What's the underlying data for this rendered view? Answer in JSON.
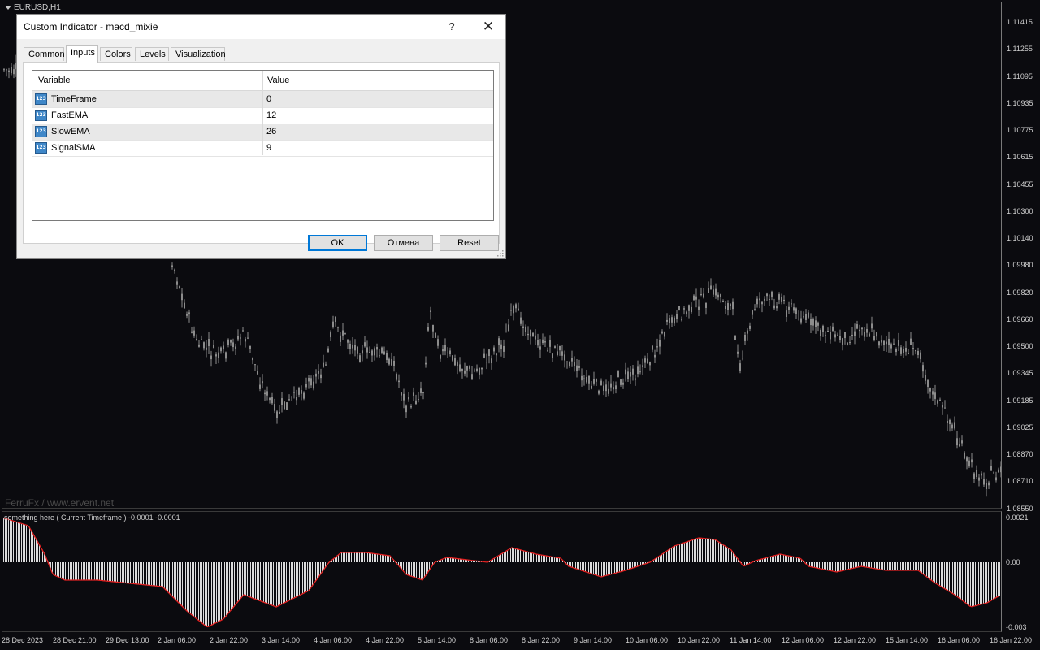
{
  "chart": {
    "symbol": "EURUSD,H1",
    "watermark": "FerruFx / www.ervent.net",
    "indicator_label": "something here ( Current Timeframe )  -0.0001 -0.0001",
    "price_axis": [
      "1.11415",
      "1.11255",
      "1.11095",
      "1.10935",
      "1.10775",
      "1.10615",
      "1.10455",
      "1.10300",
      "1.10140",
      "1.09980",
      "1.09820",
      "1.09660",
      "1.09500",
      "1.09345",
      "1.09185",
      "1.09025",
      "1.08870",
      "1.08710",
      "1.08550"
    ],
    "indicator_axis": [
      "0.0021",
      "0.00",
      "-0.003"
    ],
    "time_axis": [
      "28 Dec 2023",
      "28 Dec 21:00",
      "29 Dec 13:00",
      "2 Jan 06:00",
      "2 Jan 22:00",
      "3 Jan 14:00",
      "4 Jan 06:00",
      "4 Jan 22:00",
      "5 Jan 14:00",
      "8 Jan 06:00",
      "8 Jan 22:00",
      "9 Jan 14:00",
      "10 Jan 06:00",
      "10 Jan 22:00",
      "11 Jan 14:00",
      "12 Jan 06:00",
      "12 Jan 22:00",
      "15 Jan 14:00",
      "16 Jan 06:00",
      "16 Jan 22:00"
    ],
    "colors": {
      "background": "#0b0b0f",
      "candle": "#8c8c8c",
      "histogram": "#dcdcdc",
      "signal_line": "#e02020"
    }
  },
  "dialog": {
    "title": "Custom Indicator - macd_mixie",
    "help_label": "?",
    "close_label": "✕",
    "tabs": [
      "Common",
      "Inputs",
      "Colors",
      "Levels",
      "Visualization"
    ],
    "active_tab": "Inputs",
    "columns": {
      "variable": "Variable",
      "value": "Value"
    },
    "rows": [
      {
        "name": "TimeFrame",
        "value": "0",
        "icon": "123-int-icon"
      },
      {
        "name": "FastEMA",
        "value": "12",
        "icon": "123-int-icon"
      },
      {
        "name": "SlowEMA",
        "value": "26",
        "icon": "123-int-icon"
      },
      {
        "name": "SignalSMA",
        "value": "9",
        "icon": "123-int-icon"
      }
    ],
    "icon_text": "123",
    "buttons": {
      "ok": "OK",
      "cancel": "Отмена",
      "reset": "Reset"
    }
  }
}
